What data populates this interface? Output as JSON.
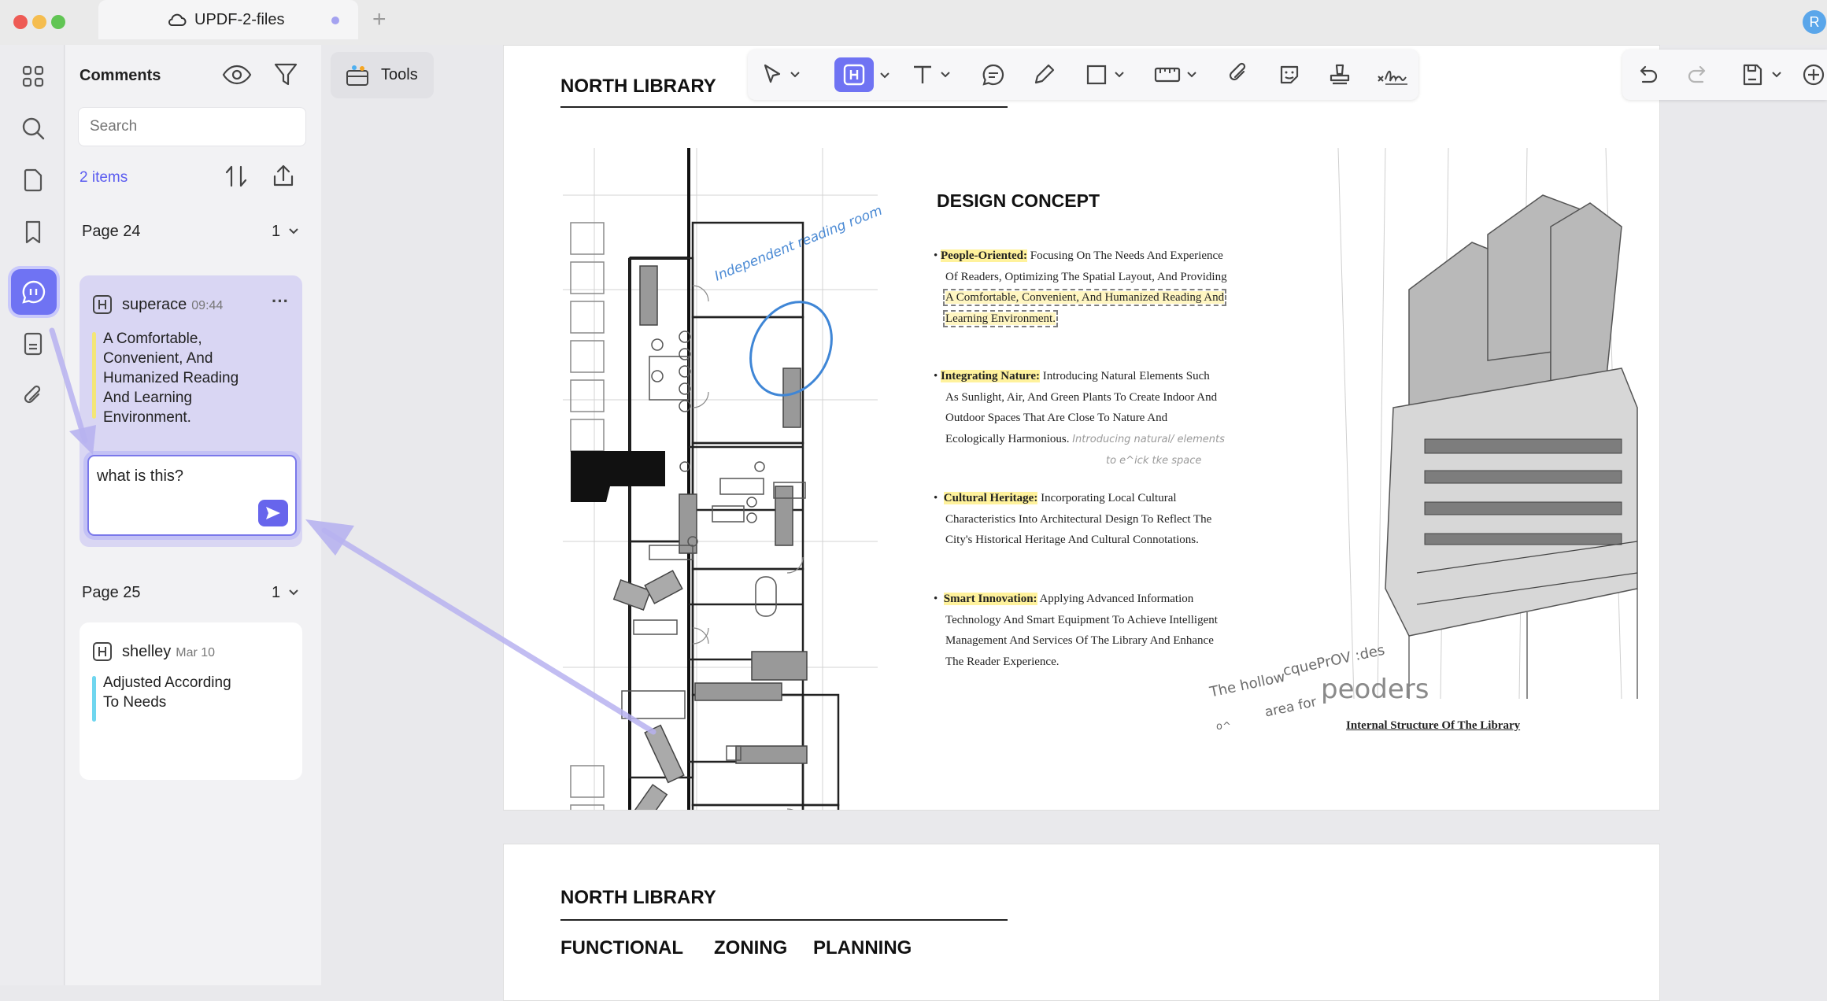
{
  "window": {
    "tab_title": "UPDF-2-files",
    "new_tab": "+",
    "avatar_initial": "R"
  },
  "comments_panel": {
    "title": "Comments",
    "search_placeholder": "Search",
    "item_count": "2 items",
    "groups": [
      {
        "page_label": "Page 24",
        "count": "1",
        "comment": {
          "author": "superace",
          "time": "09:44",
          "text": "A Comfortable, Convenient, And Humanized Reading And Learning Environment.",
          "text_lines": [
            "A Comfortable,",
            "Convenient, And",
            "Humanized Reading",
            "And Learning",
            "Environment."
          ],
          "bar_color": "#f3e676",
          "reply_input": "what is this?",
          "menu": "···"
        }
      },
      {
        "page_label": "Page 25",
        "count": "1",
        "comment": {
          "author": "shelley",
          "time": "Mar 10",
          "text_lines": [
            "Adjusted According",
            "To Needs"
          ],
          "bar_color": "#6fd6ef"
        }
      }
    ]
  },
  "tools_button": "Tools",
  "colors": {
    "accent": "#6f73f3",
    "highlight": "#fff29c"
  },
  "document": {
    "page1": {
      "heading": "NORTH LIBRARY",
      "section_title": "DESIGN CONCEPT",
      "bullets": [
        {
          "label": "People-Oriented:",
          "lines": [
            " Focusing On The        Needs And Experience",
            "Of Readers, Optimizing The Spatial Layout, And Providing"
          ],
          "highlight": [
            "A Comfortable, Convenient, And Humanized Reading And",
            "Learning Environment."
          ]
        },
        {
          "label": "Integrating Nature:",
          "lines": [
            " Introducing Natural Elements Such",
            "As Sunlight, Air, And Green Plants To Create Indoor And",
            "Outdoor Spaces That Are Close To Nature And",
            "Ecologically Harmonious."
          ],
          "note": "Introducing natural/ elements",
          "note2": "to e^ick tke space"
        },
        {
          "label": "Cultural Heritage:",
          "lines": [
            " Incorporating Local Cultural",
            "Characteristics Into Architectural Design To Reflect The",
            "City's Historical Heritage And Cultural Connotations."
          ]
        },
        {
          "label": "Smart Innovation:",
          "lines": [
            " Applying Advanced Information",
            "Technology And Smart Equipment To Achieve Intelligent",
            "Management And Services Of The Library And Enhance",
            "The Reader Experience."
          ]
        }
      ],
      "handwriting": {
        "room_note": "Independent reading room",
        "scribble_1": "The hollow",
        "scribble_2": "cquePrOV :des",
        "scribble_3": "area for",
        "scribble_4": "peoders",
        "scribble_5": "o^"
      },
      "caption": "Internal Structure Of The Library"
    },
    "page2": {
      "heading": "NORTH LIBRARY",
      "subheadings": [
        "FUNCTIONAL",
        "ZONING",
        "PLANNING"
      ]
    }
  }
}
